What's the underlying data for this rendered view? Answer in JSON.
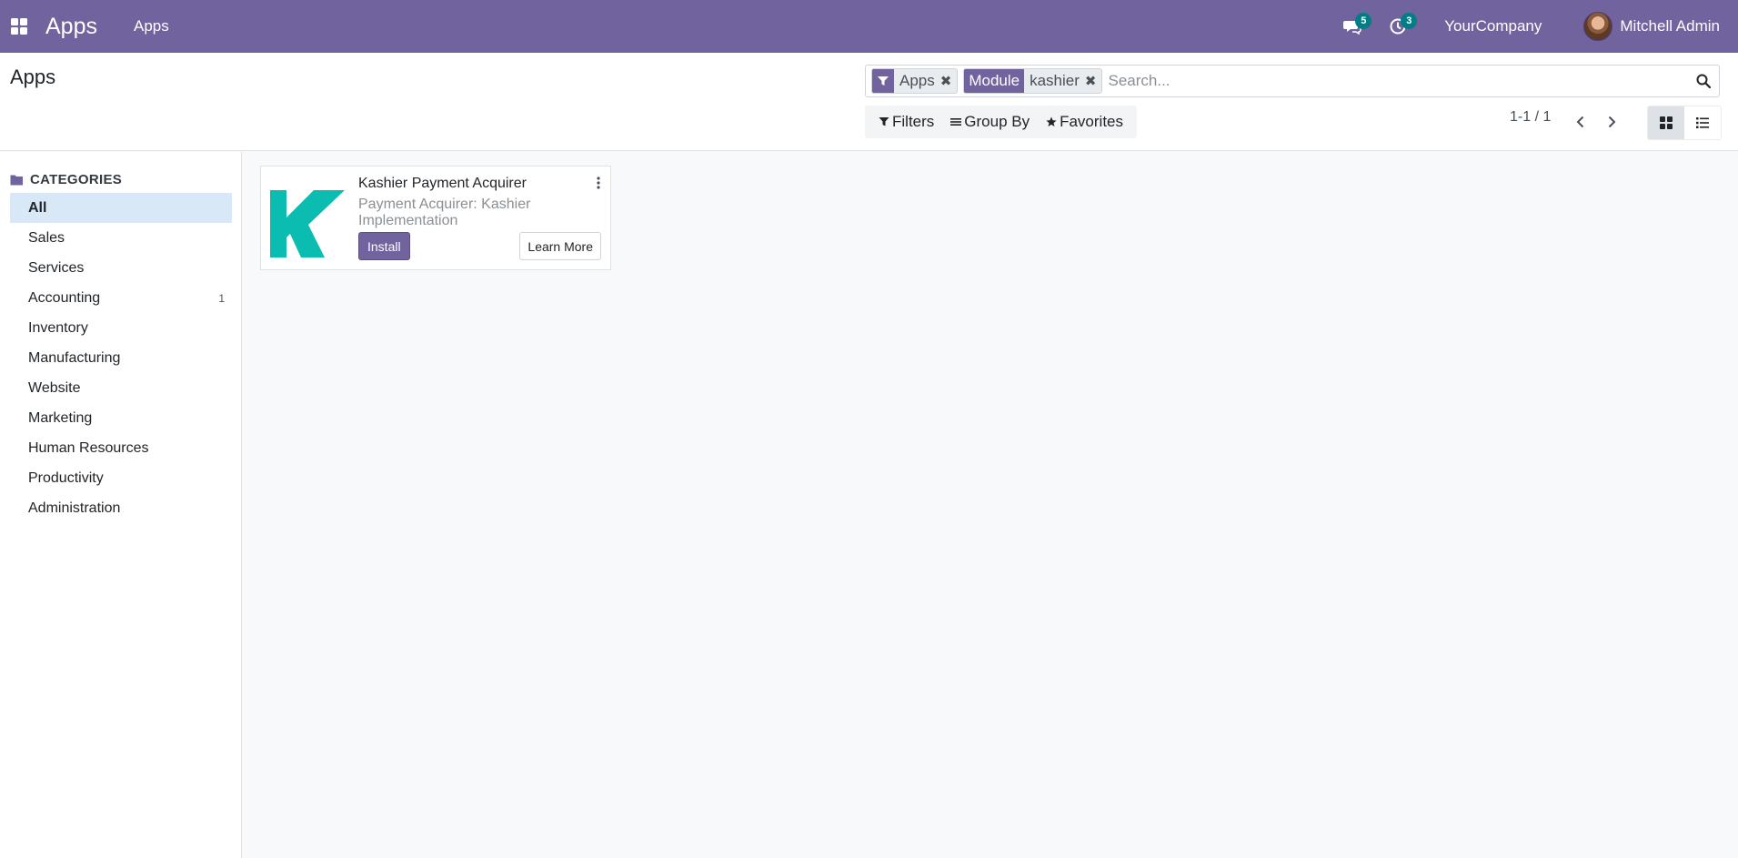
{
  "navbar": {
    "brand": "Apps",
    "menu_label": "Apps",
    "messages_count": "5",
    "activities_count": "3",
    "company": "YourCompany",
    "user_name": "Mitchell Admin"
  },
  "control_panel": {
    "title": "Apps",
    "facets": [
      {
        "label": "",
        "value": "Apps"
      },
      {
        "label": "Module",
        "value": "kashier"
      }
    ],
    "search_placeholder": "Search...",
    "filters_label": "Filters",
    "groupby_label": "Group By",
    "favorites_label": "Favorites",
    "pager": "1-1 / 1"
  },
  "sidebar": {
    "header": "CATEGORIES",
    "items": [
      {
        "label": "All",
        "count": ""
      },
      {
        "label": "Sales",
        "count": ""
      },
      {
        "label": "Services",
        "count": ""
      },
      {
        "label": "Accounting",
        "count": "1"
      },
      {
        "label": "Inventory",
        "count": ""
      },
      {
        "label": "Manufacturing",
        "count": ""
      },
      {
        "label": "Website",
        "count": ""
      },
      {
        "label": "Marketing",
        "count": ""
      },
      {
        "label": "Human Resources",
        "count": ""
      },
      {
        "label": "Productivity",
        "count": ""
      },
      {
        "label": "Administration",
        "count": ""
      }
    ]
  },
  "card": {
    "title": "Kashier Payment Acquirer",
    "summary": "Payment Acquirer: Kashier Implementation",
    "install_label": "Install",
    "learn_more_label": "Learn More"
  },
  "colors": {
    "brand": "#71639e",
    "badge": "#017e84",
    "logo": "#0bbcb0",
    "active_category": "#d8e8f6"
  }
}
